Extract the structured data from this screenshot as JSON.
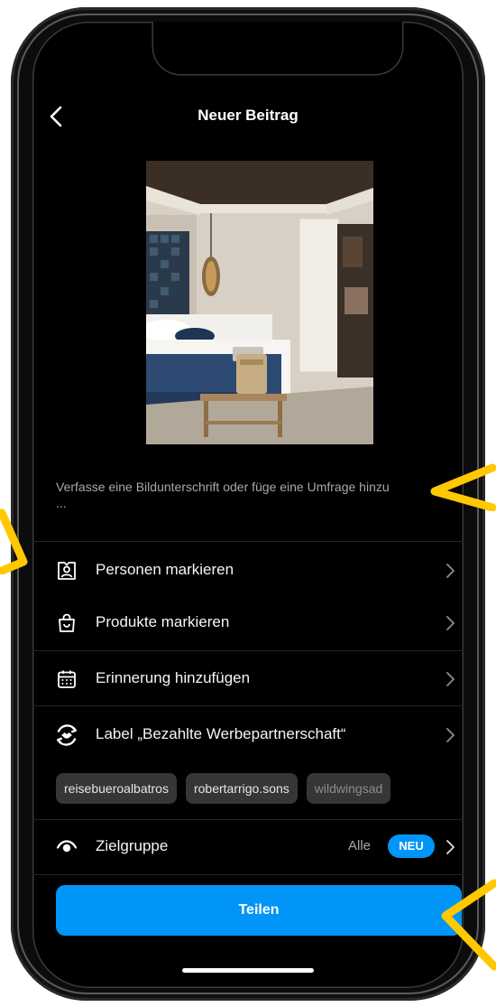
{
  "header": {
    "title": "Neuer Beitrag"
  },
  "caption": {
    "placeholder": "Verfasse eine Bildunterschrift oder füge eine Umfrage hinzu ..."
  },
  "menu": {
    "tag_people": "Personen markieren",
    "tag_products": "Produkte markieren",
    "add_reminder": "Erinnerung hinzufügen",
    "paid_partnership": "Label „Bezahlte Werbepartnerschaft“"
  },
  "partner_tags": [
    "reisebueroalbatros",
    "robertarrigo.sons",
    "wildwingsad"
  ],
  "audience": {
    "label": "Zielgruppe",
    "value": "Alle",
    "badge": "NEU"
  },
  "share_button": {
    "label": "Teilen"
  },
  "colors": {
    "accent": "#0095f6",
    "background": "#000000",
    "annotation_arrows": "#ffc800"
  },
  "icons": [
    "back-chevron-icon",
    "tag-person-icon",
    "shopping-bag-icon",
    "calendar-icon",
    "handshake-icon",
    "eye-icon",
    "chevron-right-icon",
    "annotation-arrow-icon"
  ]
}
